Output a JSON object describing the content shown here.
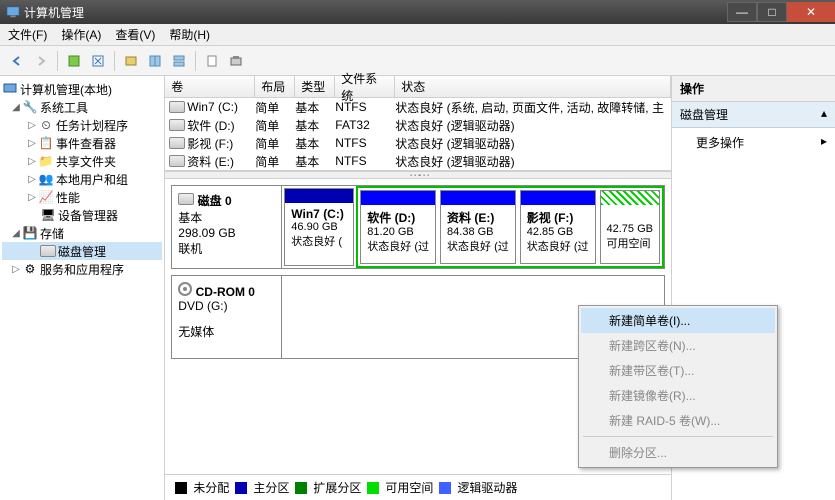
{
  "window": {
    "title": "计算机管理"
  },
  "menu": {
    "file": "文件(F)",
    "action": "操作(A)",
    "view": "查看(V)",
    "help": "帮助(H)"
  },
  "tree": {
    "root": "计算机管理(本地)",
    "system_tools": "系统工具",
    "task_scheduler": "任务计划程序",
    "event_viewer": "事件查看器",
    "shared_folders": "共享文件夹",
    "local_users": "本地用户和组",
    "performance": "性能",
    "device_manager": "设备管理器",
    "storage": "存储",
    "disk_management": "磁盘管理",
    "services_apps": "服务和应用程序"
  },
  "columns": {
    "volume": "卷",
    "layout": "布局",
    "type": "类型",
    "fs": "文件系统",
    "status": "状态"
  },
  "volumes": [
    {
      "name": "Win7 (C:)",
      "layout": "简单",
      "type": "基本",
      "fs": "NTFS",
      "status": "状态良好 (系统, 启动, 页面文件, 活动, 故障转储, 主"
    },
    {
      "name": "软件 (D:)",
      "layout": "简单",
      "type": "基本",
      "fs": "FAT32",
      "status": "状态良好 (逻辑驱动器)"
    },
    {
      "name": "影视 (F:)",
      "layout": "简单",
      "type": "基本",
      "fs": "NTFS",
      "status": "状态良好 (逻辑驱动器)"
    },
    {
      "name": "资料 (E:)",
      "layout": "简单",
      "type": "基本",
      "fs": "NTFS",
      "status": "状态良好 (逻辑驱动器)"
    }
  ],
  "disk0": {
    "name": "磁盘 0",
    "type": "基本",
    "size": "298.09 GB",
    "status": "联机",
    "parts": [
      {
        "label": "Win7  (C:)",
        "size": "46.90 GB",
        "state": "状态良好 (",
        "color": "#0000b0",
        "kind": "primary"
      },
      {
        "label": "软件  (D:)",
        "size": "81.20 GB",
        "state": "状态良好 (过",
        "color": "#0000ff",
        "kind": "logical"
      },
      {
        "label": "资料  (E:)",
        "size": "84.38 GB",
        "state": "状态良好 (过",
        "color": "#0000ff",
        "kind": "logical"
      },
      {
        "label": "影视  (F:)",
        "size": "42.85 GB",
        "state": "状态良好 (过",
        "color": "#0000ff",
        "kind": "logical"
      },
      {
        "label": "",
        "size": "42.75 GB",
        "state": "可用空间",
        "color": "#00e000",
        "kind": "free"
      }
    ]
  },
  "cdrom": {
    "name": "CD-ROM 0",
    "drive": "DVD (G:)",
    "status": "无媒体"
  },
  "legend": {
    "unallocated": "未分配",
    "primary": "主分区",
    "extended": "扩展分区",
    "free": "可用空间",
    "logical": "逻辑驱动器"
  },
  "actions": {
    "header": "操作",
    "section": "磁盘管理",
    "more": "更多操作"
  },
  "context_menu": {
    "new_simple": "新建简单卷(I)...",
    "new_spanned": "新建跨区卷(N)...",
    "new_striped": "新建带区卷(T)...",
    "new_mirror": "新建镜像卷(R)...",
    "new_raid5": "新建 RAID-5 卷(W)...",
    "delete": "删除分区..."
  }
}
